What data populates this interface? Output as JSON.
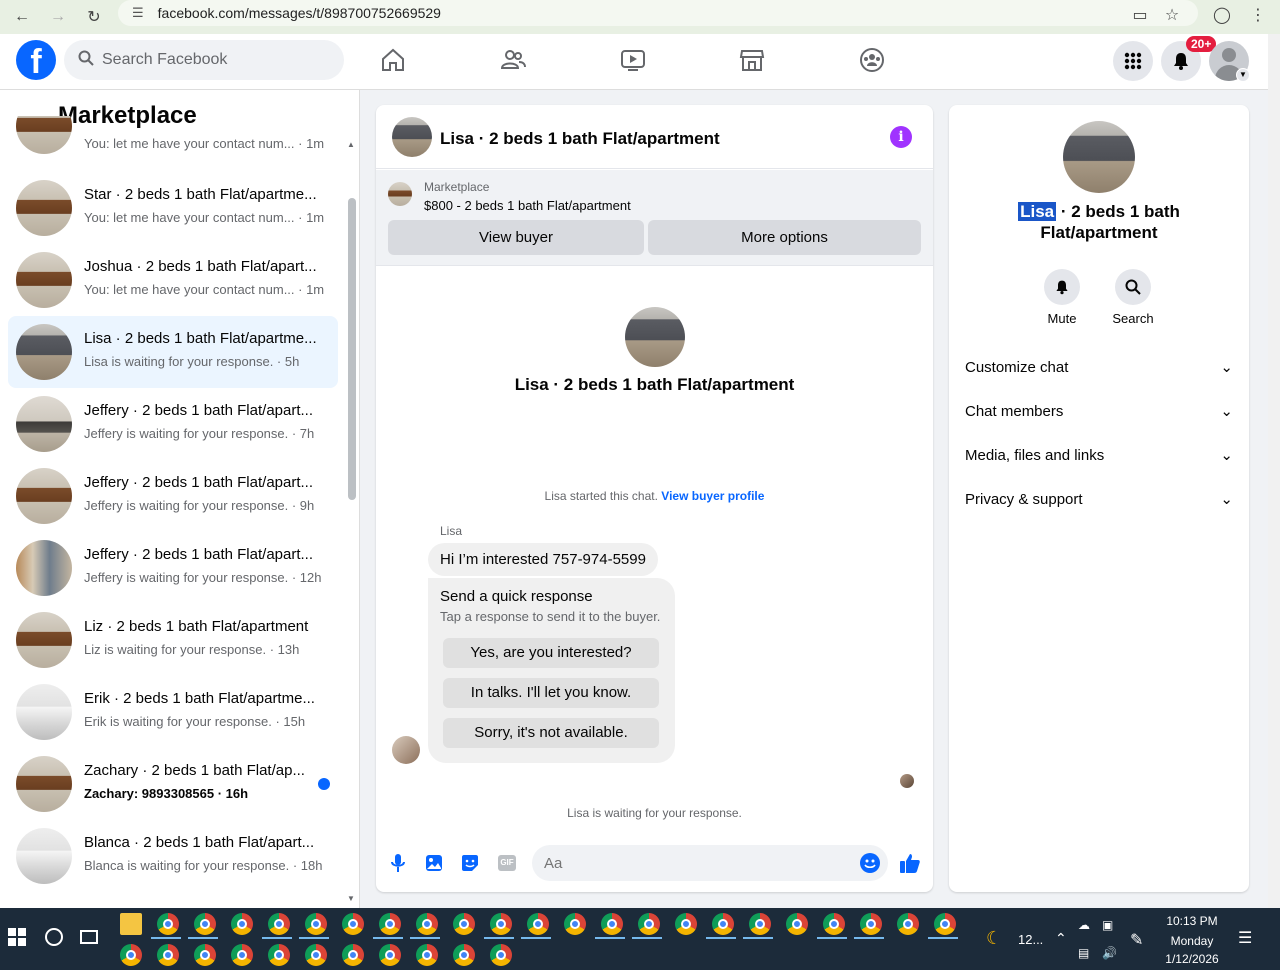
{
  "browser": {
    "url": "facebook.com/messages/t/898700752669529"
  },
  "header": {
    "search_placeholder": "Search Facebook",
    "notif_count": "20+"
  },
  "sidebar": {
    "title": "Marketplace",
    "partial_item": {
      "sub": "You: let me have your contact num... · 1m"
    },
    "items": [
      {
        "name": "Star · 2 beds 1 bath Flat/apartme...",
        "sub": "You: let me have your contact num... · 1m",
        "thumb": "kitchen",
        "bold": false,
        "unread": false,
        "active": false
      },
      {
        "name": "Joshua · 2 beds 1 bath Flat/apart...",
        "sub": "You: let me have your contact num... · 1m",
        "thumb": "kitchen",
        "bold": false,
        "unread": false,
        "active": false
      },
      {
        "name": "Lisa · 2 beds 1 bath Flat/apartme...",
        "sub": "Lisa is waiting for your response. · 5h",
        "thumb": "dark",
        "bold": false,
        "unread": false,
        "active": true
      },
      {
        "name": "Jeffery · 2 beds 1 bath Flat/apart...",
        "sub": "Jeffery is waiting for your response. · 7h",
        "thumb": "room",
        "bold": false,
        "unread": false,
        "active": false
      },
      {
        "name": "Jeffery · 2 beds 1 bath Flat/apart...",
        "sub": "Jeffery is waiting for your response. · 9h",
        "thumb": "kitchen",
        "bold": false,
        "unread": false,
        "active": false
      },
      {
        "name": "Jeffery · 2 beds 1 bath Flat/apart...",
        "sub": "Jeffery is waiting for your response. · 12h",
        "thumb": "hall",
        "bold": false,
        "unread": false,
        "active": false
      },
      {
        "name": "Liz · 2 beds 1 bath Flat/apartment",
        "sub": "Liz is waiting for your response. · 13h",
        "thumb": "kitchen",
        "bold": false,
        "unread": false,
        "active": false
      },
      {
        "name": "Erik · 2 beds 1 bath Flat/apartme...",
        "sub": "Erik is waiting for your response. · 15h",
        "thumb": "white",
        "bold": false,
        "unread": false,
        "active": false
      },
      {
        "name": "Zachary · 2 beds 1 bath Flat/ap...",
        "sub": "Zachary: 9893308565 · 16h",
        "thumb": "kitchen",
        "bold": true,
        "unread": true,
        "active": false
      },
      {
        "name": "Blanca · 2 beds 1 bath Flat/apart...",
        "sub": "Blanca is waiting for your response. · 18h",
        "thumb": "white",
        "bold": false,
        "unread": false,
        "active": false
      }
    ]
  },
  "chat": {
    "title": "Lisa · 2 beds 1 bath Flat/apartment",
    "marketplace_label": "Marketplace",
    "listing_price": "$800 - 2 beds 1 bath Flat/apartment",
    "view_buyer": "View buyer",
    "more_options": "More options",
    "center_title": "Lisa · 2 beds 1 bath Flat/apartment",
    "started_text": "Lisa started this chat.",
    "view_buyer_profile": "View buyer profile",
    "sender": "Lisa",
    "message": "Hi I’m interested 757-974-5599",
    "quick_title": "Send a quick response",
    "quick_sub": "Tap a response to send it to the buyer.",
    "quick_replies": [
      "Yes, are you interested?",
      "In talks. I'll let you know.",
      "Sorry, it's not available."
    ],
    "waiting": "Lisa is waiting for your response.",
    "input_placeholder": "Aa"
  },
  "details": {
    "name_highlight": "Lisa",
    "title_rest": " · 2 beds 1 bath Flat/apartment",
    "mute": "Mute",
    "search": "Search",
    "sections": [
      "Customize chat",
      "Chat members",
      "Media, files and links",
      "Privacy & support"
    ]
  },
  "taskbar": {
    "weather": "12...",
    "time": "10:13 PM",
    "day": "Monday",
    "date": "1/12/2026"
  },
  "colors": {
    "brand": "#0866ff",
    "info": "#a033ff",
    "badge": "#e41e3f",
    "active_row": "#ebf5ff"
  }
}
